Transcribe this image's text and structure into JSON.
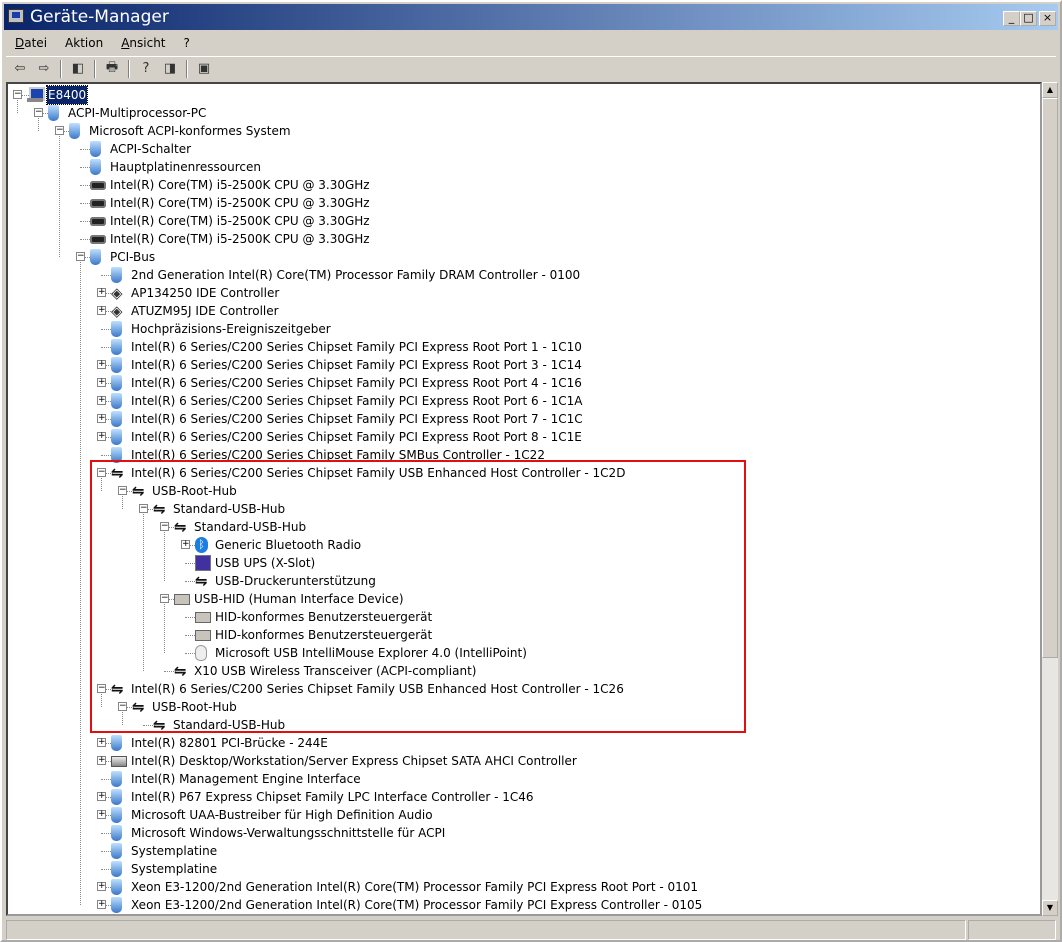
{
  "window": {
    "title": "Geräte-Manager",
    "controls": [
      "_",
      "□",
      "×"
    ]
  },
  "menu": [
    {
      "label": "Datei",
      "u": "D",
      "rest": "atei"
    },
    {
      "label": "Aktion",
      "pre": "Ak",
      "u": "t",
      "rest": "ion"
    },
    {
      "label": "Ansicht",
      "u": "A",
      "rest": "nsicht"
    },
    {
      "label": "?",
      "u": "?",
      "rest": ""
    }
  ],
  "toolbar": [
    {
      "name": "back-icon",
      "g": "⇦"
    },
    {
      "name": "forward-icon",
      "g": "⇨"
    },
    {
      "sep": true
    },
    {
      "name": "show-hide-tree-icon",
      "g": "◧"
    },
    {
      "sep": true
    },
    {
      "name": "print-icon",
      "g": "🖶"
    },
    {
      "sep": true
    },
    {
      "name": "properties-help-icon",
      "g": "?"
    },
    {
      "name": "show-hide-action-pane-icon",
      "g": "◨"
    },
    {
      "sep": true
    },
    {
      "name": "scan-hardware-icon",
      "g": "▣"
    }
  ],
  "tree": [
    {
      "l": 0,
      "e": "-",
      "i": "computer",
      "t": "E8400",
      "sel": true
    },
    {
      "l": 1,
      "e": "-",
      "i": "device",
      "t": "ACPI-Multiprocessor-PC"
    },
    {
      "l": 2,
      "e": "-",
      "i": "device",
      "t": "Microsoft ACPI-konformes System"
    },
    {
      "l": 3,
      "e": "",
      "i": "device",
      "t": "ACPI-Schalter"
    },
    {
      "l": 3,
      "e": "",
      "i": "device",
      "t": "Hauptplatinenressourcen"
    },
    {
      "l": 3,
      "e": "",
      "i": "chip",
      "t": "Intel(R) Core(TM) i5-2500K CPU @ 3.30GHz"
    },
    {
      "l": 3,
      "e": "",
      "i": "chip",
      "t": "Intel(R) Core(TM) i5-2500K CPU @ 3.30GHz"
    },
    {
      "l": 3,
      "e": "",
      "i": "chip",
      "t": "Intel(R) Core(TM) i5-2500K CPU @ 3.30GHz"
    },
    {
      "l": 3,
      "e": "",
      "i": "chip",
      "t": "Intel(R) Core(TM) i5-2500K CPU @ 3.30GHz"
    },
    {
      "l": 3,
      "e": "-",
      "i": "device",
      "t": "PCI-Bus"
    },
    {
      "l": 4,
      "e": "",
      "i": "device",
      "t": "2nd Generation Intel(R) Core(TM) Processor Family DRAM Controller - 0100"
    },
    {
      "l": 4,
      "e": "+",
      "i": "ide",
      "t": "AP134250 IDE Controller"
    },
    {
      "l": 4,
      "e": "+",
      "i": "ide",
      "t": "ATUZM95J IDE Controller"
    },
    {
      "l": 4,
      "e": "",
      "i": "device",
      "t": "Hochpräzisions-Ereigniszeitgeber"
    },
    {
      "l": 4,
      "e": "",
      "i": "device",
      "t": "Intel(R) 6 Series/C200 Series Chipset Family PCI Express Root Port 1 - 1C10"
    },
    {
      "l": 4,
      "e": "+",
      "i": "device",
      "t": "Intel(R) 6 Series/C200 Series Chipset Family PCI Express Root Port 3 - 1C14"
    },
    {
      "l": 4,
      "e": "+",
      "i": "device",
      "t": "Intel(R) 6 Series/C200 Series Chipset Family PCI Express Root Port 4 - 1C16"
    },
    {
      "l": 4,
      "e": "+",
      "i": "device",
      "t": "Intel(R) 6 Series/C200 Series Chipset Family PCI Express Root Port 6 - 1C1A"
    },
    {
      "l": 4,
      "e": "+",
      "i": "device",
      "t": "Intel(R) 6 Series/C200 Series Chipset Family PCI Express Root Port 7 - 1C1C"
    },
    {
      "l": 4,
      "e": "+",
      "i": "device",
      "t": "Intel(R) 6 Series/C200 Series Chipset Family PCI Express Root Port 8 - 1C1E"
    },
    {
      "l": 4,
      "e": "",
      "i": "device",
      "t": "Intel(R) 6 Series/C200 Series Chipset Family SMBus Controller - 1C22"
    },
    {
      "l": 4,
      "e": "-",
      "i": "usb",
      "t": "Intel(R) 6 Series/C200 Series Chipset Family USB Enhanced Host Controller - 1C2D"
    },
    {
      "l": 5,
      "e": "-",
      "i": "usb",
      "t": "USB-Root-Hub"
    },
    {
      "l": 6,
      "e": "-",
      "i": "usb",
      "t": "Standard-USB-Hub"
    },
    {
      "l": 7,
      "e": "-",
      "i": "usb",
      "t": "Standard-USB-Hub"
    },
    {
      "l": 8,
      "e": "+",
      "i": "bt",
      "t": "Generic Bluetooth Radio"
    },
    {
      "l": 8,
      "e": "",
      "i": "ups",
      "t": "USB UPS (X-Slot)"
    },
    {
      "l": 8,
      "e": "",
      "i": "usb",
      "t": "USB-Druckerunterstützung"
    },
    {
      "l": 7,
      "e": "-",
      "i": "hid",
      "t": "USB-HID (Human Interface Device)"
    },
    {
      "l": 8,
      "e": "",
      "i": "hid",
      "t": "HID-konformes Benutzersteuergerät"
    },
    {
      "l": 8,
      "e": "",
      "i": "hid",
      "t": "HID-konformes Benutzersteuergerät"
    },
    {
      "l": 8,
      "e": "",
      "i": "mouse",
      "t": "Microsoft USB IntelliMouse Explorer 4.0 (IntelliPoint)"
    },
    {
      "l": 7,
      "e": "",
      "i": "usb",
      "t": "X10 USB Wireless Transceiver (ACPI-compliant)"
    },
    {
      "l": 4,
      "e": "-",
      "i": "usb",
      "t": "Intel(R) 6 Series/C200 Series Chipset Family USB Enhanced Host Controller - 1C26"
    },
    {
      "l": 5,
      "e": "-",
      "i": "usb",
      "t": "USB-Root-Hub"
    },
    {
      "l": 6,
      "e": "",
      "i": "usb",
      "t": "Standard-USB-Hub"
    },
    {
      "l": 4,
      "e": "+",
      "i": "device",
      "t": "Intel(R) 82801 PCI-Brücke - 244E"
    },
    {
      "l": 4,
      "e": "+",
      "i": "disk",
      "t": "Intel(R) Desktop/Workstation/Server Express Chipset SATA AHCI Controller"
    },
    {
      "l": 4,
      "e": "",
      "i": "device",
      "t": "Intel(R) Management Engine Interface"
    },
    {
      "l": 4,
      "e": "+",
      "i": "device",
      "t": "Intel(R) P67 Express Chipset Family LPC Interface Controller - 1C46"
    },
    {
      "l": 4,
      "e": "+",
      "i": "device",
      "t": "Microsoft UAA-Bustreiber für High Definition Audio"
    },
    {
      "l": 4,
      "e": "",
      "i": "device",
      "t": "Microsoft Windows-Verwaltungsschnittstelle für ACPI"
    },
    {
      "l": 4,
      "e": "",
      "i": "device",
      "t": "Systemplatine"
    },
    {
      "l": 4,
      "e": "",
      "i": "device",
      "t": "Systemplatine"
    },
    {
      "l": 4,
      "e": "+",
      "i": "device",
      "t": "Xeon E3-1200/2nd Generation Intel(R) Core(TM) Processor Family PCI Express Root Port - 0101"
    },
    {
      "l": 4,
      "e": "+",
      "i": "device",
      "t": "Xeon E3-1200/2nd Generation Intel(R) Core(TM) Processor Family PCI Express Controller - 0105"
    }
  ],
  "highlight_color": "#e01010"
}
